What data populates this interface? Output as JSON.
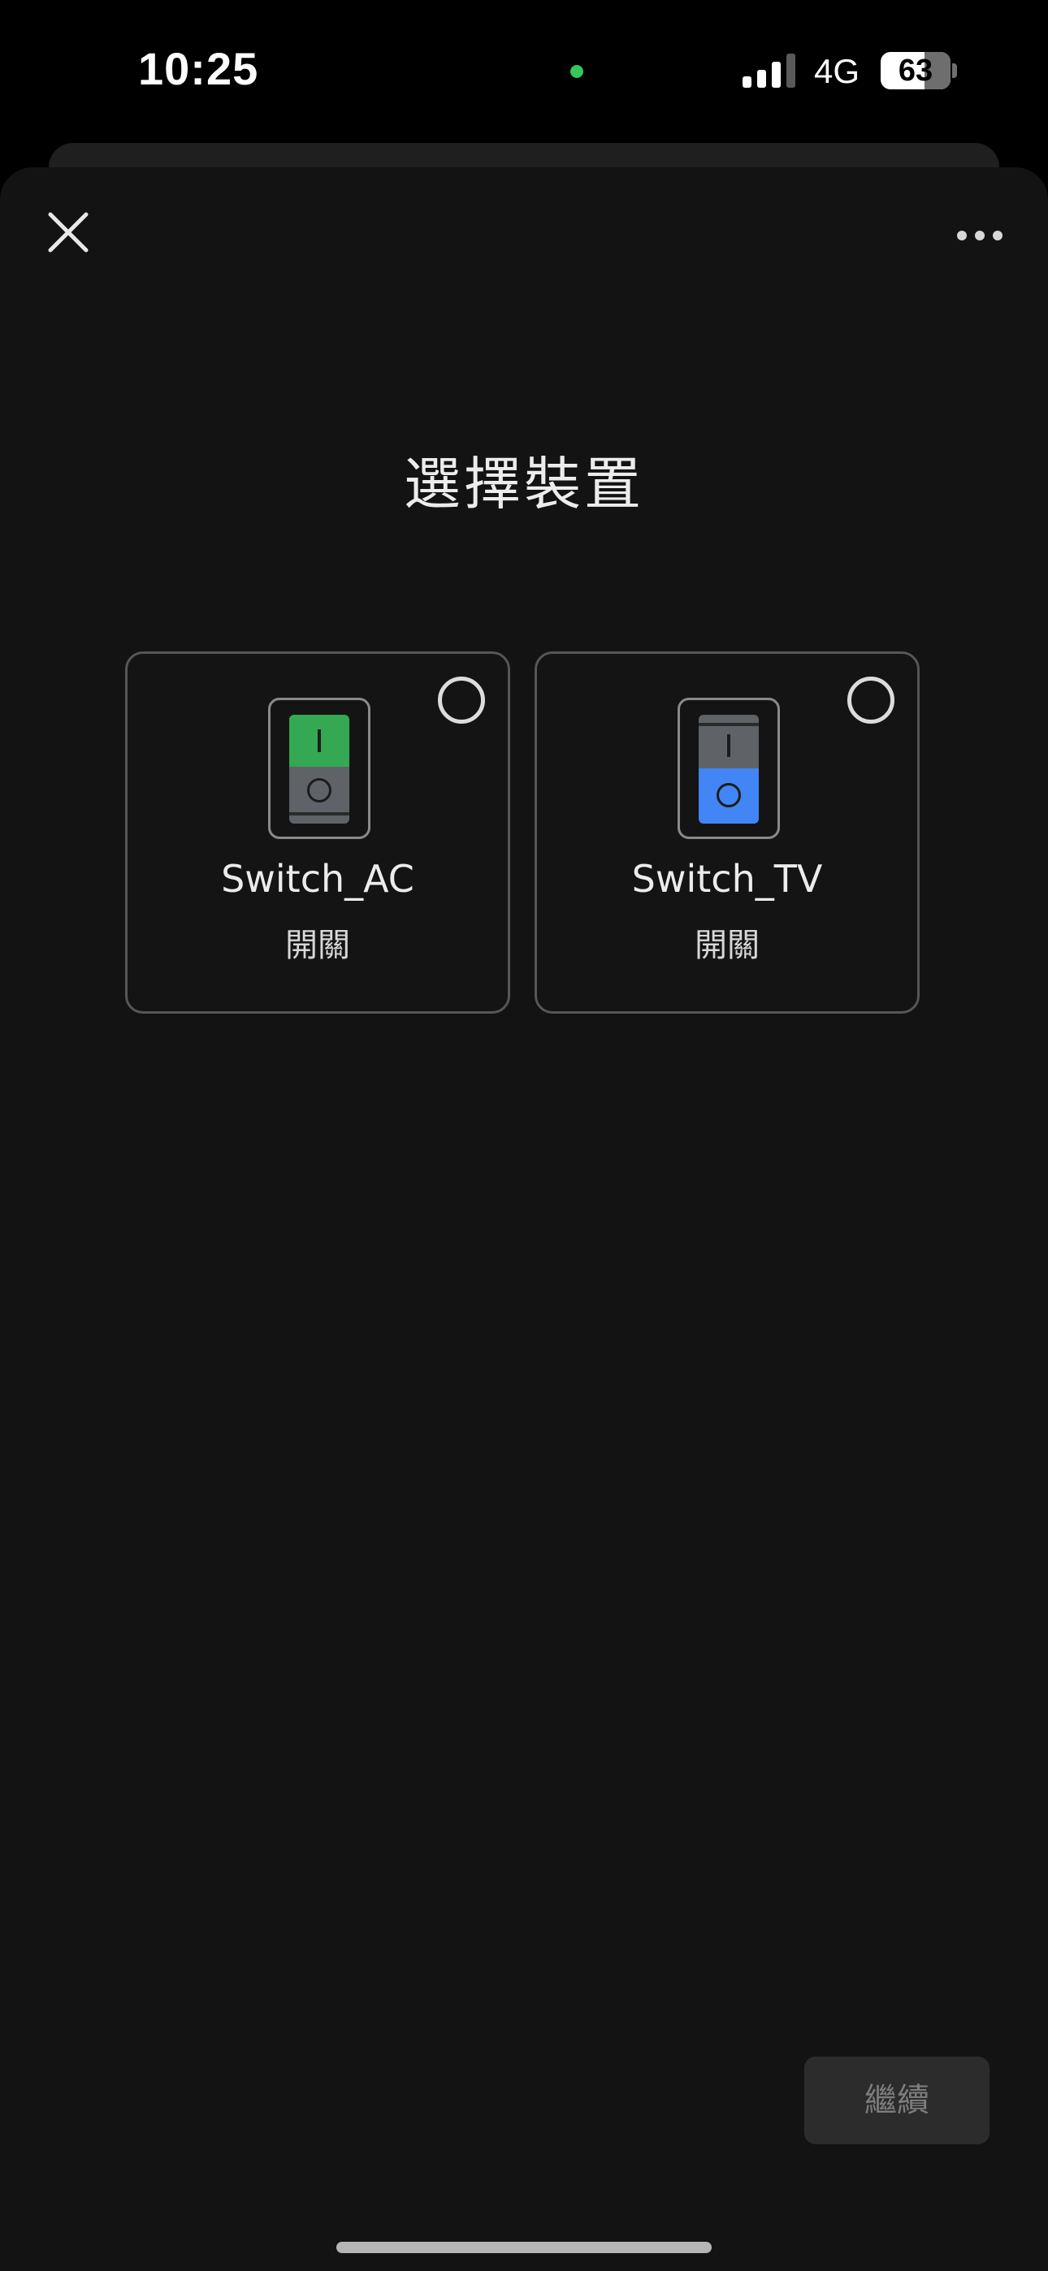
{
  "status_bar": {
    "time": "10:25",
    "network": "4G",
    "battery_percent": "63",
    "battery_level": 0.63,
    "signal_bars_active": 3,
    "signal_bars_total": 4,
    "camera_indicator_color": "#34c759"
  },
  "header": {
    "close_icon": "close-icon",
    "more_icon": "more-horizontal-icon"
  },
  "title": "選擇裝置",
  "devices": [
    {
      "name": "Switch_AC",
      "type": "開關",
      "icon": "rocker-switch-icon",
      "selected": false,
      "accent": "#34a853",
      "state": "on"
    },
    {
      "name": "Switch_TV",
      "type": "開關",
      "icon": "rocker-switch-icon",
      "selected": false,
      "accent": "#4285f4",
      "state": "off"
    }
  ],
  "footer": {
    "continue_label": "繼續",
    "continue_enabled": false
  }
}
